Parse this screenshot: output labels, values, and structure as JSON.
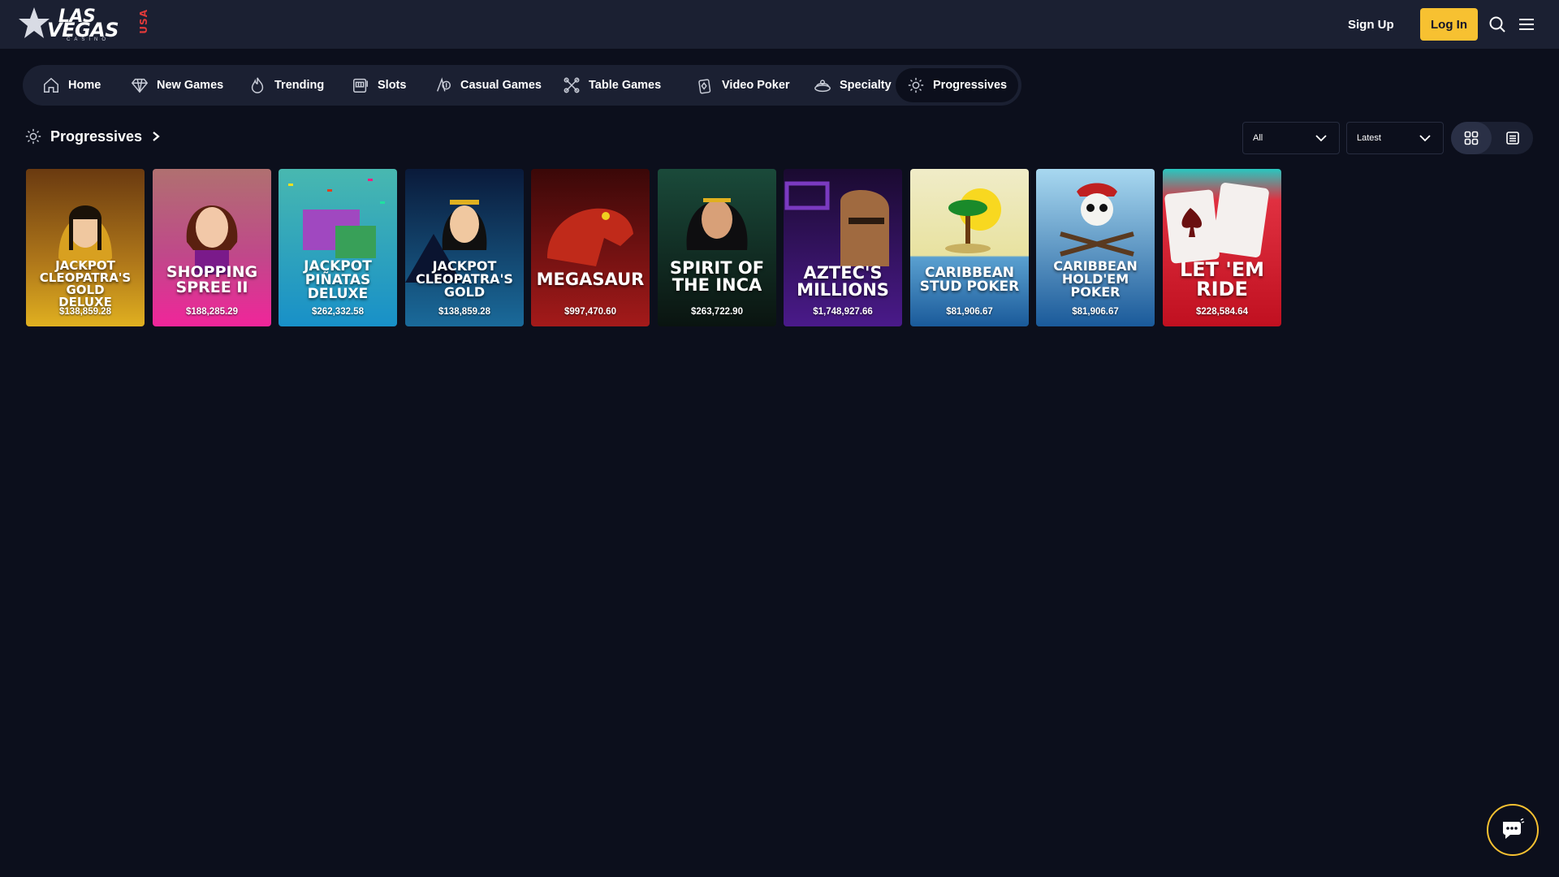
{
  "header": {
    "logo": {
      "line1": "LAS",
      "line2": "VEGAS",
      "badge": "USA",
      "sub": "CASINO"
    },
    "signup_label": "Sign Up",
    "login_label": "Log In",
    "icons": [
      "search-icon",
      "menu-icon"
    ],
    "colors": {
      "bg": "#1b2032",
      "login_bg": "#f7c131"
    }
  },
  "nav": {
    "items": [
      {
        "label": "Home",
        "icon": "home-icon"
      },
      {
        "label": "New Games",
        "icon": "diamond-icon"
      },
      {
        "label": "Trending",
        "icon": "flame-icon"
      },
      {
        "label": "Slots",
        "icon": "slot-machine-icon"
      },
      {
        "label": "Casual Games",
        "icon": "casual-games-icon"
      },
      {
        "label": "Table Games",
        "icon": "table-games-icon"
      },
      {
        "label": "Video Poker",
        "icon": "video-poker-icon"
      },
      {
        "label": "Specialty",
        "icon": "specialty-icon"
      },
      {
        "label": "Progressives",
        "icon": "progressives-icon",
        "active": true
      }
    ]
  },
  "section": {
    "title": "Progressives",
    "filter": {
      "selected": "All"
    },
    "sort": {
      "selected": "Latest"
    },
    "view_modes": [
      "grid-view",
      "list-view"
    ],
    "active_view": "grid-view"
  },
  "games": [
    {
      "title": "JACKPOT\nCLEOPATRA'S\nGOLD\nDELUXE",
      "amount": "$138,859.28",
      "bg": [
        "#7a4a12",
        "#d9a21c"
      ]
    },
    {
      "title": "SHOPPING\nSPREE II",
      "amount": "$188,285.29",
      "bg": [
        "#8a2a5a",
        "#f0259a"
      ]
    },
    {
      "title": "JACKPOT\nPIÑATAS\nDELUXE",
      "amount": "$262,332.58",
      "bg": [
        "#3ab0b8",
        "#1b8fc8"
      ]
    },
    {
      "title": "JACKPOT\nCLEOPATRA'S\nGOLD",
      "amount": "$138,859.28",
      "bg": [
        "#0e2a5c",
        "#1a6a9a"
      ]
    },
    {
      "title": "MEGASAUR",
      "amount": "$997,470.60",
      "bg": [
        "#5a1010",
        "#a41a1a"
      ]
    },
    {
      "title": "SPIRIT OF\nTHE INCA",
      "amount": "$263,722.90",
      "bg": [
        "#1a3a30",
        "#0e2018"
      ]
    },
    {
      "title": "AZTEC'S\nMILLIONS",
      "amount": "$1,748,927.66",
      "bg": [
        "#2a0e4a",
        "#4a1a8a"
      ]
    },
    {
      "title": "CARIBBEAN\nSTUD POKER",
      "amount": "$81,906.67",
      "bg": [
        "#e8e2a0",
        "#1a6aa8"
      ]
    },
    {
      "title": "CARIBBEAN\nHOLD'EM\nPOKER",
      "amount": "$81,906.67",
      "bg": [
        "#8ec8e8",
        "#1a5a9a"
      ]
    },
    {
      "title": "LET 'EM\nRIDE",
      "amount": "$228,584.64",
      "bg": [
        "#2ac8c0",
        "#d81a2a"
      ]
    }
  ],
  "chat": {
    "icon": "chat-icon",
    "border": "#f7c131"
  }
}
